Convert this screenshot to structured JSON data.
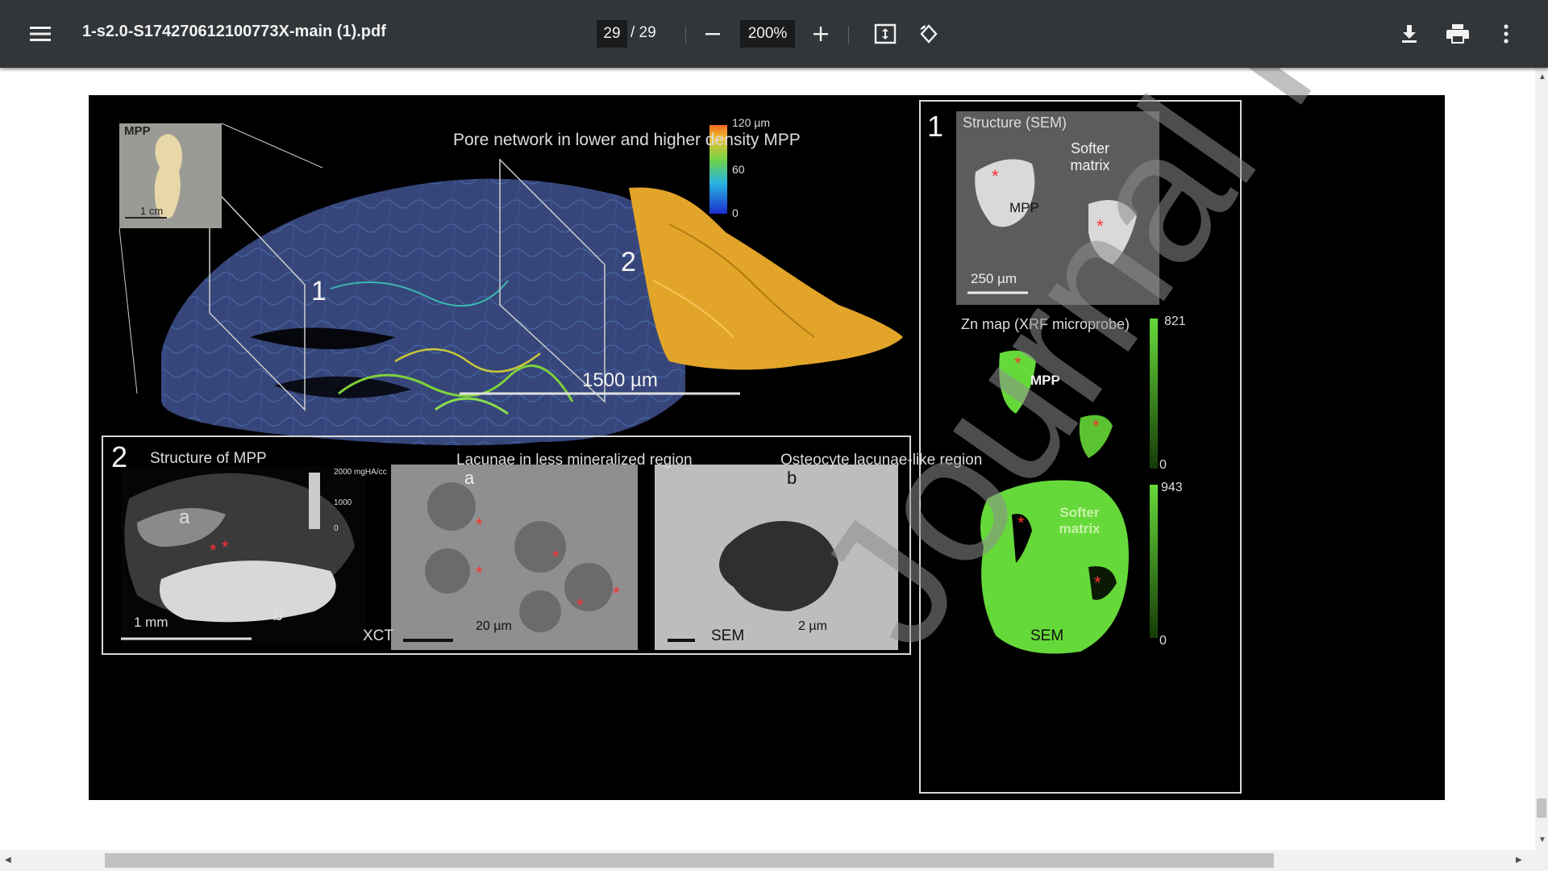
{
  "toolbar": {
    "title": "1-s2.0-S174270612100773X-main (1).pdf",
    "current_page": "29",
    "page_total": "/  29",
    "zoom": "200%",
    "icons": [
      "menu-icon",
      "zoom-out-icon",
      "zoom-in-icon",
      "fit-page-icon",
      "rotate-icon",
      "download-icon",
      "print-icon",
      "more-options-icon"
    ]
  },
  "figure": {
    "top": {
      "inset_label": "MPP",
      "inset_scale": "1 cm",
      "title": "Pore network in lower and higher density MPP",
      "colorbar_max": "120 µm",
      "colorbar_mid": "60",
      "colorbar_min": "0",
      "marker_1": "1",
      "marker_2": "2",
      "scale": "1500 µm"
    },
    "panel2": {
      "number": "2",
      "title": "Structure of MPP",
      "legend_top": "2000 mgHA/cc",
      "legend_mid": "1000",
      "legend_bottom": "0",
      "region_a": "a",
      "region_b": "b",
      "scale": "1 mm",
      "modality": "XCT"
    },
    "panel_a": {
      "title": "Lacunae in less mineralized region",
      "letter": "a",
      "scale": "20 µm",
      "modality": "SEM"
    },
    "panel_b": {
      "title": "Osteocyte lacunae-like region",
      "letter": "b",
      "scale": "2 µm",
      "modality": "SEM"
    },
    "panel1": {
      "number": "1",
      "sem_title": "Structure (SEM)",
      "softer_matrix": "Softer matrix",
      "mpp_label": "MPP",
      "sem_scale": "250 µm",
      "zn_title": "Zn map (XRF microprobe)",
      "zn_max1": "821",
      "zn_min1": "0",
      "zn_max2": "943",
      "zn_min2": "0",
      "zn_mpp": "MPP",
      "zn_softer": "Softer matrix"
    },
    "watermark": "Journal Pre-proof"
  },
  "colors": {
    "toolbar_bg": "#323639",
    "figure_bg": "#000000",
    "scaffold_blue": "#3a4b7e",
    "dense_gold": "#e7a52a",
    "zn_green": "#66d93a",
    "marker_red": "#ff3030"
  }
}
